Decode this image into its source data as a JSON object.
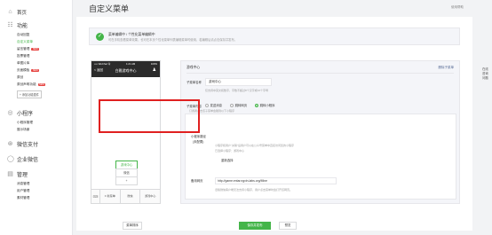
{
  "sidebar": {
    "home": "首页",
    "function_group": "功能",
    "function_items": [
      {
        "label": "自动回复",
        "active": false,
        "badge": ""
      },
      {
        "label": "自定义菜单",
        "active": true,
        "badge": ""
      },
      {
        "label": "留言管理",
        "active": false,
        "badge": "NEW"
      },
      {
        "label": "投票管理",
        "active": false,
        "badge": ""
      },
      {
        "label": "单图片库",
        "active": false,
        "badge": ""
      },
      {
        "label": "页面模板",
        "active": false,
        "badge": "NEW"
      },
      {
        "label": "原创",
        "active": false,
        "badge": ""
      },
      {
        "label": "原创声明功能",
        "active": false,
        "badge": "NEW"
      }
    ],
    "add_plugin": "+ 添加功能插件",
    "miniprogram_group": "小程序",
    "miniprogram_items": [
      "小程序管理",
      "展示场景"
    ],
    "wechat_pay": "微信支付",
    "enterprise_wechat": "企业微信",
    "manage_group": "管理",
    "manage_items": [
      "消息管理",
      "用户管理",
      "素材管理"
    ]
  },
  "header": {
    "title": "自定义菜单",
    "help": "使用帮助"
  },
  "notice": {
    "line1": "菜单编辑中 / 个性化菜单编辑中",
    "line2": "可在手机查看菜单效果，也可在本页个性化菜单列表编辑菜单时使用，若编辑后请点击保存并发布，"
  },
  "phone": {
    "carrier": "•••• WeChat 令",
    "time": "1:21 AM",
    "battery": "100%",
    "back": "< 返回",
    "title": "白雅游戏中心",
    "submenu": [
      "游戏中心",
      "微信",
      "+"
    ],
    "footer": [
      "≡ 新菜单",
      "微信",
      "游戏中心"
    ]
  },
  "editor": {
    "title": "游戏中心",
    "delete": "删除子菜单",
    "name_label": "子菜单名称",
    "name_value": "游戏中心",
    "name_hint": "仅支持中英文和数字，字数不超过8个汉字或16个字母",
    "content_label": "子菜单内容",
    "content_options": [
      {
        "label": "发送消息",
        "selected": false
      },
      {
        "label": "跳转网页",
        "selected": false
      },
      {
        "label": "跳转小程序",
        "selected": true
      }
    ],
    "info_note": "订阅者点击该子菜单会跳到以下小程序",
    "mini_label": "小程序路径",
    "mini_status": "(未配置)",
    "mini_hint1": "小程序和用户“关联”后用户可以在公众号菜单中直接访问您的小程序",
    "mini_hint2": "已选择小程序：游戏中心",
    "reselect": "重新选择",
    "backup_label": "备用网页",
    "backup_url": "http://game.entar.ngxin-labs.org/Mine",
    "backup_hint": "旧版微信客户端无法支持小程序，用户点击菜单时会打开该网页。"
  },
  "bottom": {
    "sort": "菜单排序",
    "save": "保存并发布",
    "preview": "预览"
  },
  "float_tip": "在线咨询问题",
  "colors": {
    "accent": "#44b549",
    "highlight": "#e02020",
    "link": "#576b95"
  }
}
